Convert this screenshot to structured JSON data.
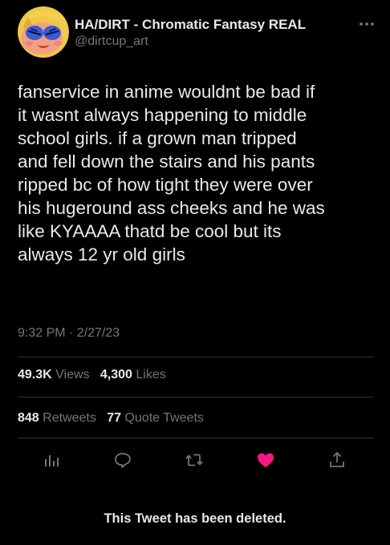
{
  "author": {
    "display_name": "HA/DIRT - Chromatic Fantasy REAL",
    "handle": "@dirtcup_art",
    "avatar_icon": "cartoon-face-avatar"
  },
  "tweet": {
    "text": "fanservice in anime wouldnt be bad if\nit wasnt always happening to middle\nschool girls. if a grown man tripped\nand fell down the stairs and his pants\nripped bc of how tight they were over\nhis hugeround ass cheeks and he was\nlike KYAAAA thatd be cool but its\nalways 12 yr old girls",
    "timestamp": "9:32 PM · 2/27/23"
  },
  "stats": {
    "views_count": "49.3K",
    "views_label": "Views",
    "likes_count": "4,300",
    "likes_label": "Likes",
    "retweets_count": "848",
    "retweets_label": "Retweets",
    "quotes_count": "77",
    "quotes_label": "Quote Tweets"
  },
  "actions": {
    "icons": [
      "analytics-icon",
      "reply-icon",
      "retweet-icon",
      "like-heart-icon",
      "share-icon"
    ]
  },
  "notice": {
    "text": "This Tweet has been deleted."
  },
  "colors": {
    "background": "#000000",
    "text_primary": "#e7e9ea",
    "text_secondary": "#71767b",
    "divider": "#2f3336",
    "like_pink": "#f91880"
  }
}
